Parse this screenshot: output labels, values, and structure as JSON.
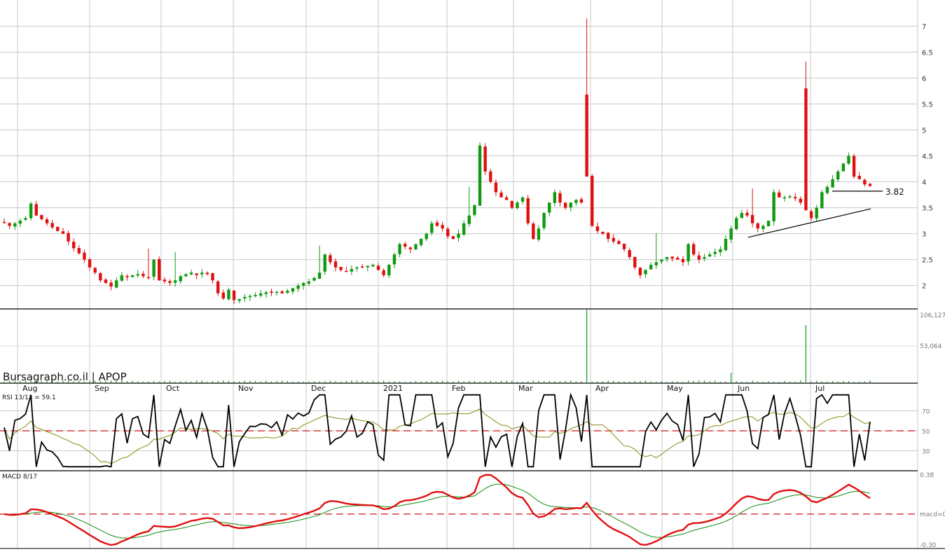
{
  "brand": "Bursagraph.co.il | APOP",
  "chart_data": [
    {
      "panel": "price",
      "type": "candlestick",
      "ylim": [
        1.55,
        7.45
      ],
      "y_ticks": [
        "2",
        "2.5",
        "3",
        "3.5",
        "4",
        "4.5",
        "5",
        "5.5",
        "6",
        "6.5",
        "7"
      ],
      "x_ticks": [
        "Aug",
        "Sep",
        "Oct",
        "Nov",
        "Dec",
        "2021",
        "Feb",
        "Mar",
        "Apr",
        "May",
        "Jun",
        "Jul"
      ],
      "grid": true,
      "up_color": "#119a11",
      "down_color": "#e01010",
      "annotation": {
        "label": "3.82",
        "value": 3.82
      },
      "support_line": {
        "from": 2.93,
        "to": 3.48
      },
      "close": [
        3.22,
        3.15,
        3.2,
        3.25,
        3.3,
        3.58,
        3.35,
        3.28,
        3.2,
        3.12,
        3.05,
        3.0,
        2.85,
        2.72,
        2.62,
        2.5,
        2.35,
        2.25,
        2.1,
        2.05,
        1.98,
        2.1,
        2.2,
        2.16,
        2.2,
        2.22,
        2.18,
        2.15,
        2.5,
        2.1,
        2.08,
        2.05,
        2.1,
        2.18,
        2.22,
        2.25,
        2.2,
        2.25,
        2.22,
        2.1,
        1.85,
        1.75,
        1.92,
        1.72,
        1.74,
        1.78,
        1.8,
        1.82,
        1.85,
        1.87,
        1.86,
        1.88,
        1.85,
        1.9,
        1.95,
        2.0,
        2.05,
        2.08,
        2.15,
        2.25,
        2.6,
        2.45,
        2.35,
        2.3,
        2.28,
        2.32,
        2.35,
        2.36,
        2.38,
        2.4,
        2.3,
        2.2,
        2.4,
        2.6,
        2.8,
        2.75,
        2.7,
        2.8,
        2.9,
        3.0,
        3.2,
        3.15,
        3.1,
        2.95,
        2.9,
        3.0,
        3.2,
        3.35,
        3.55,
        4.7,
        4.2,
        4.0,
        3.8,
        3.7,
        3.65,
        3.5,
        3.6,
        3.7,
        3.2,
        2.9,
        3.1,
        3.4,
        3.6,
        3.8,
        3.6,
        3.5,
        3.6,
        3.65,
        3.6,
        4.1,
        3.15,
        3.05,
        3.0,
        2.9,
        2.85,
        2.8,
        2.7,
        2.55,
        2.35,
        2.2,
        2.3,
        2.4,
        2.45,
        2.5,
        2.55,
        2.52,
        2.5,
        2.45,
        2.8,
        2.6,
        2.5,
        2.55,
        2.6,
        2.65,
        2.7,
        2.9,
        3.1,
        3.3,
        3.4,
        3.35,
        3.2,
        3.1,
        3.15,
        3.25,
        3.8,
        3.7,
        3.7,
        3.72,
        3.68,
        3.6,
        3.45,
        3.3,
        3.5,
        3.8,
        3.9,
        4.05,
        4.2,
        4.35,
        4.5,
        4.1,
        4.05,
        3.95,
        3.92
      ]
    },
    {
      "panel": "volume",
      "type": "bar",
      "y_ticks": [
        "106,127",
        "53,064"
      ],
      "ylim": [
        0,
        106127
      ]
    },
    {
      "panel": "rsi",
      "type": "line",
      "label": "RSI 13/13 = 59.1",
      "value": 59.1,
      "y_ticks": [
        "70",
        "50",
        "30"
      ],
      "ylim": [
        10,
        90
      ],
      "reference_line": 50
    },
    {
      "panel": "macd",
      "type": "line",
      "label": "MACD 8/17",
      "y_ticks": [
        "0.38",
        "macd=0",
        "-0.30"
      ],
      "ylim": [
        -0.3,
        0.38
      ],
      "reference_line": 0
    }
  ]
}
